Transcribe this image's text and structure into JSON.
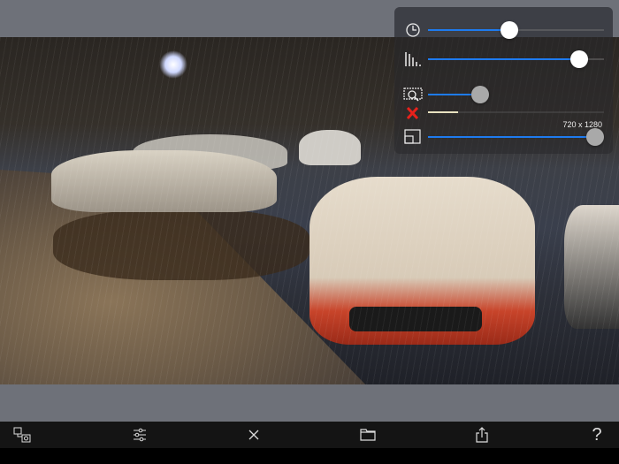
{
  "panel": {
    "sliders": [
      {
        "icon": "clock-icon",
        "value": 0.46,
        "enabled": true
      },
      {
        "icon": "equalizer-bars-icon",
        "value": 0.86,
        "enabled": true
      },
      {
        "icon": "film-zoom-icon",
        "value": 0.2,
        "enabled": false
      },
      {
        "icon": "red-x-icon",
        "value": 0.17,
        "enabled": false
      },
      {
        "icon": "resolution-icon",
        "value": 0.95,
        "enabled": false
      }
    ],
    "resolution_label": "720 x 1280",
    "accent": "#1e7bef"
  },
  "toolbar": {
    "help_label": "?"
  }
}
